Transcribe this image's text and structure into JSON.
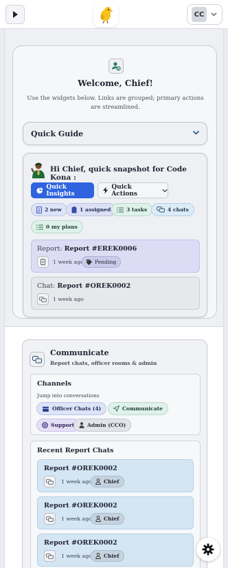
{
  "topbar": {
    "user_initials": "CC"
  },
  "welcome": {
    "title": "Welcome, Chief!",
    "subtitle": "Use the widgets below. Links are grouped; primary actions are streamlined."
  },
  "quick_guide": {
    "label": "Quick Guide"
  },
  "snapshot": {
    "title": "Hi Chief, quick snapshot for Code Kona :",
    "quick_insights_label": "Quick Insights",
    "quick_actions_label": "Quick Actions",
    "pills": {
      "new": "2 new",
      "assigned": "1 assigned",
      "tasks": "3 tasks",
      "chats": "4 chats",
      "plans": "0 my plans"
    },
    "report_card": {
      "key": "Report:",
      "value": "Report #EREK0006",
      "time": "1 week ago",
      "status": "Pending"
    },
    "chat_card": {
      "key": "Chat:",
      "value": "Report #OREK0002",
      "time": "1 week ago"
    }
  },
  "communicate": {
    "title": "Communicate",
    "subtitle": "Report chats, officer rooms & admin",
    "channels": {
      "title": "Channels",
      "subtitle": "Jump into conversations",
      "officer_chats": "Officer Chats (4)",
      "communicate": "Communicate",
      "support": "Support",
      "admin": "Admin (CCO)"
    },
    "recent": {
      "title": "Recent Report Chats",
      "items": [
        {
          "title": "Report #OREK0002",
          "time": "1 week ago",
          "role": "Chief"
        },
        {
          "title": "Report #OREK0002",
          "time": "1 week ago",
          "role": "Chief"
        },
        {
          "title": "Report #OREK0002",
          "time": "1 week ago",
          "role": "Chief"
        }
      ]
    }
  },
  "colors": {
    "primary": "#2f63e0",
    "report_card_bg": "#dcddf5",
    "chat_item_bg": "#d4e6f3"
  }
}
